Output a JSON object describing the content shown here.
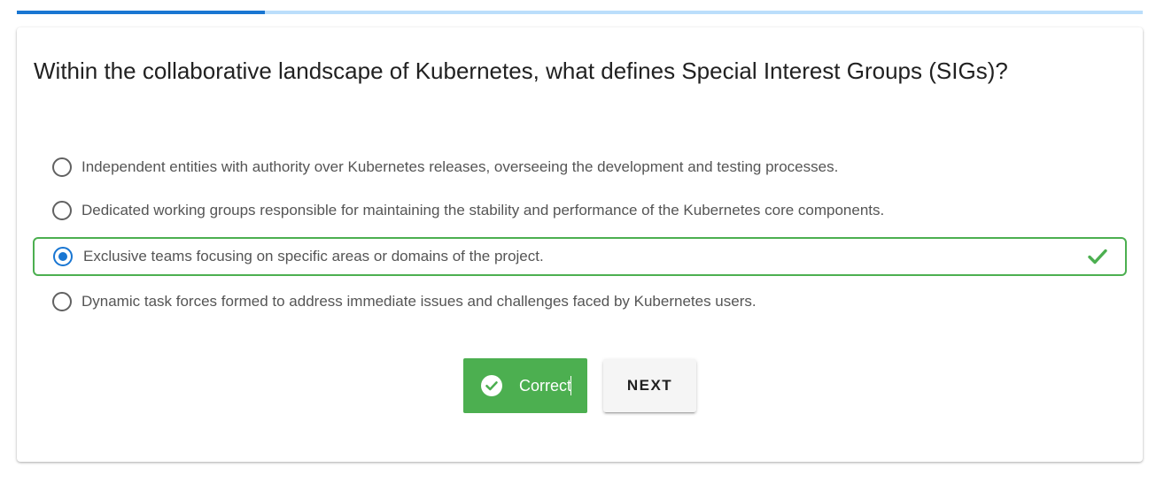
{
  "progress": {
    "fraction": 0.22
  },
  "quiz": {
    "question": "Within the collaborative landscape of Kubernetes, what defines Special Interest Groups (SIGs)?",
    "options": [
      {
        "label": "Independent entities with authority over Kubernetes releases, overseeing the development and testing processes.",
        "selected": false,
        "correct": false
      },
      {
        "label": "Dedicated working groups responsible for maintaining the stability and performance of the Kubernetes core components.",
        "selected": false,
        "correct": false
      },
      {
        "label": "Exclusive teams focusing on specific areas or domains of the project.",
        "selected": true,
        "correct": true
      },
      {
        "label": "Dynamic task forces formed to address immediate issues and challenges faced by Kubernetes users.",
        "selected": false,
        "correct": false
      }
    ]
  },
  "buttons": {
    "result_label": "Correct",
    "result_icon": "check-circle-icon",
    "next_label": "NEXT"
  },
  "colors": {
    "accent": "#1976d2",
    "progress_track": "#bbdefb",
    "success": "#4caf50",
    "next_bg": "#f5f5f5"
  }
}
